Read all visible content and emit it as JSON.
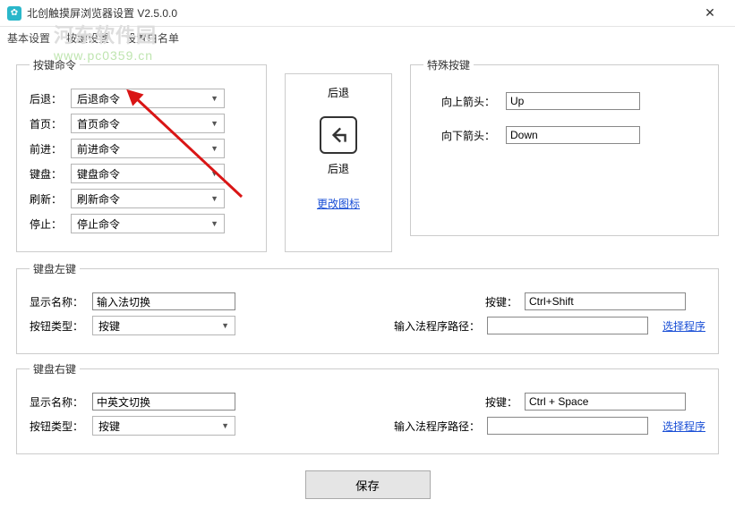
{
  "window": {
    "title": "北创触摸屏浏览器设置 V2.5.0.0",
    "close": "✕"
  },
  "menu": {
    "basic": "基本设置",
    "keys": "按键设置",
    "whitelist": "设置白名单"
  },
  "watermark": {
    "line1": "河东软件园",
    "line2": "www.pc0359.cn"
  },
  "cmd": {
    "legend": "按键命令",
    "rows": {
      "back": {
        "label": "后退：",
        "value": "后退命令"
      },
      "home": {
        "label": "首页：",
        "value": "首页命令"
      },
      "fwd": {
        "label": "前进：",
        "value": "前进命令"
      },
      "kbd": {
        "label": "键盘：",
        "value": "键盘命令"
      },
      "refresh": {
        "label": "刷新：",
        "value": "刷新命令"
      },
      "stop": {
        "label": "停止：",
        "value": "停止命令"
      }
    }
  },
  "preview": {
    "title": "后退",
    "label": "后退",
    "change": "更改图标"
  },
  "special": {
    "legend": "特殊按键",
    "up": {
      "label": "向上箭头：",
      "value": "Up"
    },
    "down": {
      "label": "向下箭头：",
      "value": "Down"
    }
  },
  "kbLeft": {
    "legend": "键盘左键",
    "name_label": "显示名称：",
    "name_value": "输入法切换",
    "type_label": "按钮类型：",
    "type_value": "按键",
    "hotkey_label": "按键：",
    "hotkey_value": "Ctrl+Shift",
    "path_label": "输入法程序路径：",
    "path_value": "",
    "choose": "选择程序"
  },
  "kbRight": {
    "legend": "键盘右键",
    "name_label": "显示名称：",
    "name_value": "中英文切换",
    "type_label": "按钮类型：",
    "type_value": "按键",
    "hotkey_label": "按键：",
    "hotkey_value": "Ctrl + Space",
    "path_label": "输入法程序路径：",
    "path_value": "",
    "choose": "选择程序"
  },
  "save": "保存"
}
